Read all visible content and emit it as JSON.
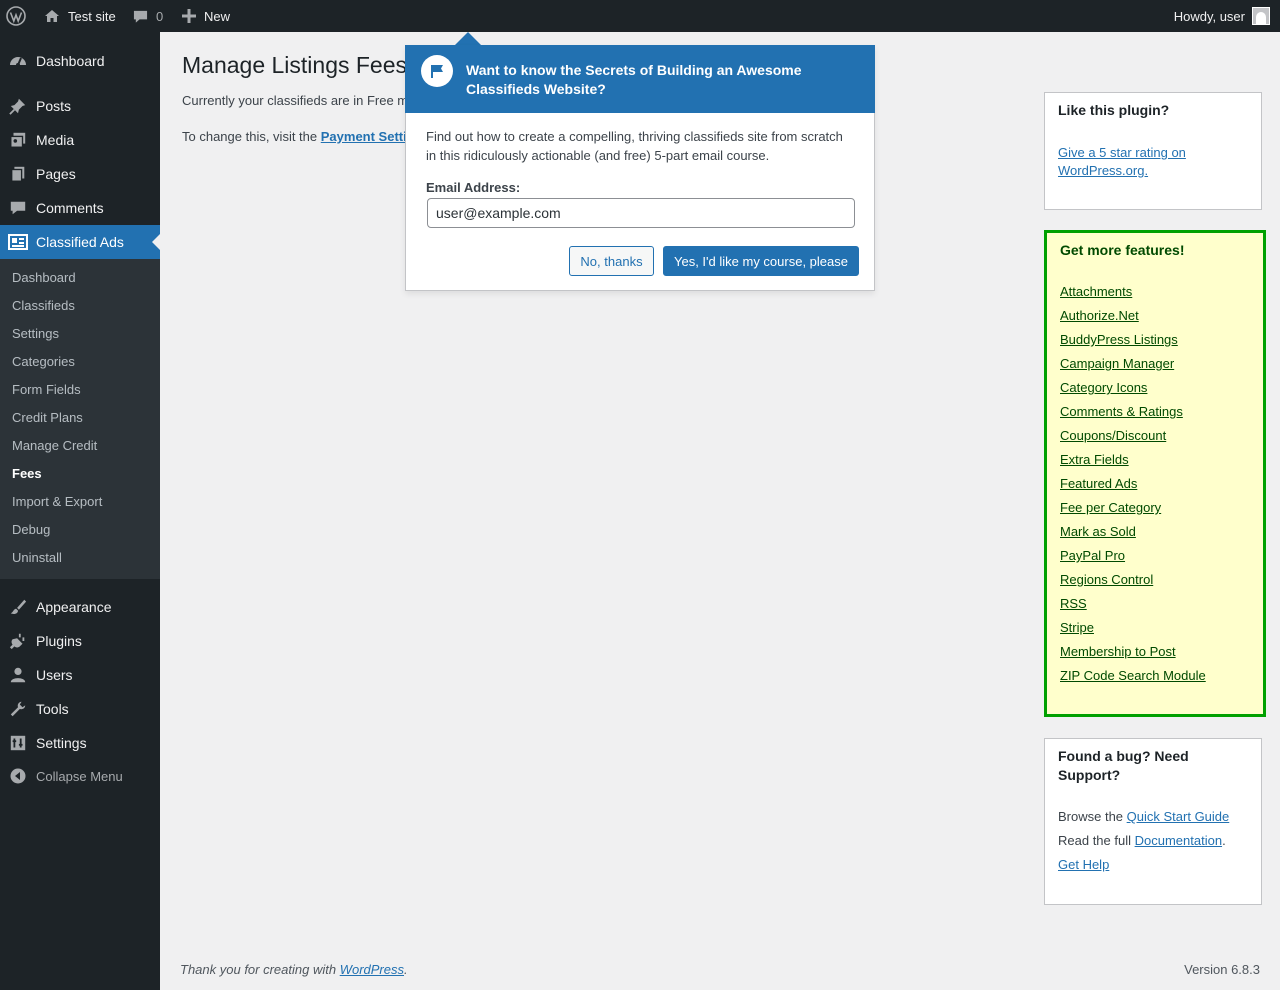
{
  "adminbar": {
    "site_name": "Test site",
    "comments_count": "0",
    "new_label": "New",
    "howdy": "Howdy, user"
  },
  "sidebar": {
    "items": [
      {
        "label": "Dashboard",
        "icon": "dashboard-icon"
      },
      {
        "label": "Posts",
        "icon": "pin-icon"
      },
      {
        "label": "Media",
        "icon": "media-icon"
      },
      {
        "label": "Pages",
        "icon": "pages-icon"
      },
      {
        "label": "Comments",
        "icon": "comment-icon"
      },
      {
        "label": "Classified Ads",
        "icon": "classified-icon"
      },
      {
        "label": "Appearance",
        "icon": "brush-icon"
      },
      {
        "label": "Plugins",
        "icon": "plug-icon"
      },
      {
        "label": "Users",
        "icon": "user-icon"
      },
      {
        "label": "Tools",
        "icon": "wrench-icon"
      },
      {
        "label": "Settings",
        "icon": "settings-icon"
      }
    ],
    "collapse_label": "Collapse Menu",
    "submenu": [
      "Dashboard",
      "Classifieds",
      "Settings",
      "Categories",
      "Form Fields",
      "Credit Plans",
      "Manage Credit",
      "Fees",
      "Import & Export",
      "Debug",
      "Uninstall"
    ],
    "current_submenu": "Fees"
  },
  "main": {
    "title": "Manage Listings Fees",
    "line1": "Currently your classifieds are in Free m",
    "line2_prefix": "To change this, visit the ",
    "line2_link": "Payment Setti"
  },
  "pointer": {
    "title": "Want to know the Secrets of Building an Awesome Classifieds Website?",
    "text": "Find out how to create a compelling, thriving classifieds site from scratch in this ridiculously actionable (and free) 5-part email course.",
    "email_label": "Email Address:",
    "email_value": "user@example.com",
    "no_button": "No, thanks",
    "yes_button": "Yes, I'd like my course, please"
  },
  "like_box": {
    "title": "Like this plugin?",
    "link": "Give a 5 star rating on WordPress.org."
  },
  "features_box": {
    "title": "Get more features!",
    "links": [
      "Attachments",
      "Authorize.Net",
      "BuddyPress Listings",
      "Campaign Manager",
      "Category Icons",
      "Comments & Ratings",
      "Coupons/Discount",
      "Extra Fields",
      "Featured Ads",
      "Fee per Category",
      "Mark as Sold",
      "PayPal Pro",
      "Regions Control",
      "RSS",
      "Stripe",
      "Membership to Post",
      "ZIP Code Search Module"
    ]
  },
  "support_box": {
    "title": "Found a bug? Need Support?",
    "browse_prefix": "Browse the ",
    "quick_start": "Quick Start Guide",
    "read_prefix": "Read the full ",
    "documentation": "Documentation",
    "read_suffix": ".",
    "get_help": "Get Help"
  },
  "footer": {
    "thanks_prefix": "Thank you for creating with ",
    "wordpress": "WordPress",
    "thanks_suffix": ".",
    "version": "Version 6.8.3"
  },
  "colors": {
    "adminbar_bg": "#1d2327",
    "accent": "#2271b1",
    "features_bg": "#ffffcc",
    "features_border": "#00a000"
  }
}
